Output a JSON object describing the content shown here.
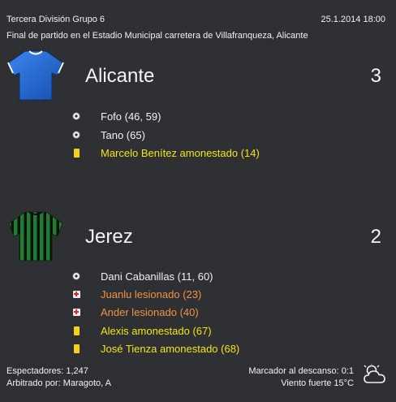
{
  "header": {
    "competition": "Tercera División Grupo 6",
    "date_time": "25.1.2014 18:00",
    "subtitle": "Final de partido en el Estadio Municipal carretera de Villafranqueza, Alicante"
  },
  "home": {
    "name": "Alicante",
    "score": "3",
    "shirt_colors": [
      "#1f62c9",
      "#ffffff"
    ],
    "events": [
      {
        "icon": "ball-icon",
        "text": "Fofo (46, 59)",
        "color": "white"
      },
      {
        "icon": "ball-icon",
        "text": "Tano (65)",
        "color": "white"
      },
      {
        "icon": "yellow-card-icon",
        "text": "Marcelo Benítez amonestado (14)",
        "color": "yellow"
      }
    ]
  },
  "away": {
    "name": "Jerez",
    "score": "2",
    "shirt_colors": [
      "#1d6e2a",
      "#0b0b0b"
    ],
    "events": [
      {
        "icon": "ball-icon",
        "text": "Dani Cabanillas (11, 60)",
        "color": "white"
      },
      {
        "icon": "injury-icon",
        "text": "Juanlu lesionado (23)",
        "color": "orange"
      },
      {
        "icon": "injury-icon",
        "text": "Ander lesionado (40)",
        "color": "orange"
      },
      {
        "icon": "yellow-card-icon",
        "text": "Alexis amonestado (67)",
        "color": "yellow"
      },
      {
        "icon": "yellow-card-icon",
        "text": "José Tienza amonestado (68)",
        "color": "yellow"
      }
    ]
  },
  "footer": {
    "attendance": "Espectadores: 1,247",
    "referee": "Arbitrado por: Maragoto, A",
    "halftime": "Marcador al descanso: 0:1",
    "weather": "Viento fuerte 15°C",
    "weather_icon": "cloudy-icon"
  }
}
